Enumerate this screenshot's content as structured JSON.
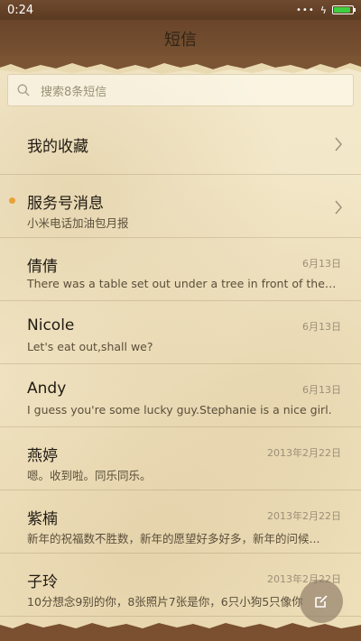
{
  "status_bar": {
    "time": "0:24",
    "icons": [
      "dots-icon",
      "bolt-icon",
      "battery-icon"
    ],
    "battery_level_percent": 90
  },
  "header": {
    "title": "短信"
  },
  "search": {
    "placeholder": "搜索8条短信"
  },
  "favorites": {
    "label": "我的收藏"
  },
  "service": {
    "label": "服务号消息",
    "subtitle": "小米电话加油包月报",
    "unread_dot_color": "#e8a23a"
  },
  "conversations": [
    {
      "name": "倩倩",
      "date": "6月13日",
      "preview": "There was a table set out under a tree in front of the ho..."
    },
    {
      "name": "Nicole",
      "date": "6月13日",
      "preview": "Let's eat out,shall we?"
    },
    {
      "name": "Andy",
      "date": "6月13日",
      "preview": "I guess you're some lucky guy.Stephanie is a nice girl."
    },
    {
      "name": "燕婷",
      "date": "2013年2月22日",
      "preview": "嗯。收到啦。同乐同乐。"
    },
    {
      "name": "紫楠",
      "date": "2013年2月22日",
      "preview": "新年的祝福数不胜数，新年的愿望好多好多，新年的问候..."
    },
    {
      "name": "子玲",
      "date": "2013年2月22日",
      "preview": "10分想念9别的你，8张照片7张是你，6只小狗5只像你"
    }
  ],
  "fab": {
    "icon": "compose-icon"
  },
  "colors": {
    "accent_dot": "#e8a23a",
    "battery": "#3ecf3e",
    "header_brown": "#6a452a"
  }
}
